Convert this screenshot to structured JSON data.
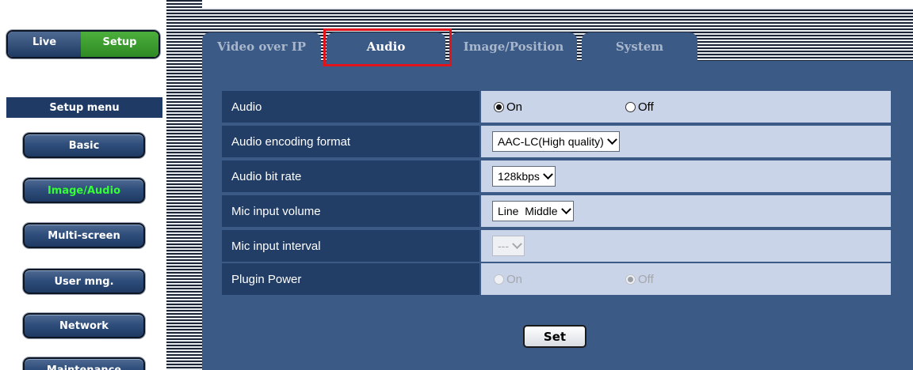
{
  "top_nav": {
    "live_label": "Live",
    "setup_label": "Setup"
  },
  "sidebar": {
    "title": "Setup menu",
    "items": [
      {
        "label": "Basic",
        "active": false
      },
      {
        "label": "Image/Audio",
        "active": true
      },
      {
        "label": "Multi-screen",
        "active": false
      },
      {
        "label": "User mng.",
        "active": false
      },
      {
        "label": "Network",
        "active": false
      },
      {
        "label": "Maintenance",
        "active": false
      }
    ]
  },
  "tabs": [
    {
      "label": "Video over IP",
      "selected": false
    },
    {
      "label": "Audio",
      "selected": true
    },
    {
      "label": "Image/Position",
      "selected": false
    },
    {
      "label": "System",
      "selected": false
    }
  ],
  "settings": {
    "audio": {
      "label": "Audio",
      "options": [
        "On",
        "Off"
      ],
      "selected": "On"
    },
    "encoding": {
      "label": "Audio encoding format",
      "value": "AAC-LC(High quality)"
    },
    "bitrate": {
      "label": "Audio bit rate",
      "value": "128kbps"
    },
    "mic_volume": {
      "label": "Mic input volume",
      "value": "Line  Middle"
    },
    "mic_interval": {
      "label": "Mic input interval",
      "value": "---"
    },
    "plugin_power": {
      "label": "Plugin Power",
      "options": [
        "On",
        "Off"
      ],
      "selected": "Off"
    }
  },
  "set_button": "Set",
  "colors": {
    "panel": "#3b5a86",
    "label_cell": "#223d66",
    "value_cell": "#c9d4e8",
    "active_menu_text": "#33ff33",
    "setup_button": "#2e8a24",
    "tab_highlight": "#e1141c"
  }
}
